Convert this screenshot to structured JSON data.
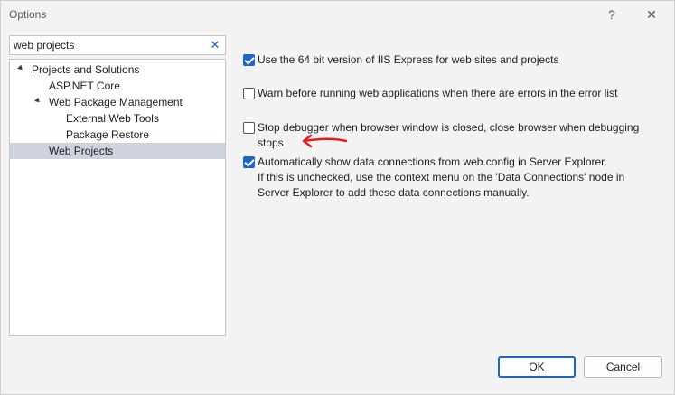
{
  "window": {
    "title": "Options"
  },
  "titlebar": {
    "help_glyph": "?",
    "close_glyph": "✕"
  },
  "search": {
    "value": "web projects",
    "clear_glyph": "✕"
  },
  "tree": {
    "items": [
      {
        "label": "Projects and Solutions",
        "expanded": true,
        "selected": false
      },
      {
        "label": "ASP.NET Core",
        "expanded": false,
        "selected": false
      },
      {
        "label": "Web Package Management",
        "expanded": true,
        "selected": false
      },
      {
        "label": "External Web Tools",
        "expanded": false,
        "selected": false
      },
      {
        "label": "Package Restore",
        "expanded": false,
        "selected": false
      },
      {
        "label": "Web Projects",
        "expanded": false,
        "selected": true
      }
    ]
  },
  "options": [
    {
      "checked": true,
      "lines": [
        "Use the 64 bit version of IIS Express for web sites and projects"
      ]
    },
    {
      "checked": false,
      "lines": [
        "Warn before running web applications when there are errors in the error list"
      ]
    },
    {
      "checked": false,
      "lines": [
        "Stop debugger when browser window is closed, close browser when debugging",
        "stops"
      ]
    },
    {
      "checked": true,
      "lines": [
        "Automatically show data connections from web.config in Server Explorer.",
        "If this is unchecked, use the context menu on the 'Data Connections' node in",
        "Server Explorer to add these data connections manually."
      ]
    }
  ],
  "buttons": {
    "ok": "OK",
    "cancel": "Cancel"
  },
  "colors": {
    "accent": "#1a66c9",
    "selection": "#cfd3de",
    "annotation": "#e02020"
  },
  "icons": {
    "help": "help-icon",
    "close": "close-icon",
    "clear": "clear-search-icon",
    "expanded": "expanded-triangle-icon",
    "annotation": "red-arrow-annotation"
  }
}
